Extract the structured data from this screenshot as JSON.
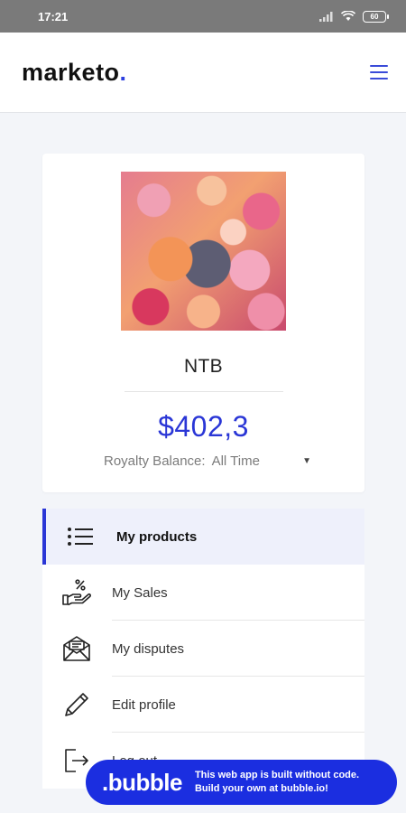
{
  "status_bar": {
    "time": "17:21",
    "battery": "60"
  },
  "header": {
    "logo_text": "marketo",
    "logo_dot": "."
  },
  "profile": {
    "name": "NTB",
    "balance": "$402,3",
    "balance_label": "Royalty Balance:",
    "balance_period": "All Time"
  },
  "nav": {
    "items": [
      {
        "label": "My products",
        "icon": "list-icon",
        "active": true
      },
      {
        "label": "My Sales",
        "icon": "hand-percent-icon",
        "active": false
      },
      {
        "label": "My disputes",
        "icon": "envelope-icon",
        "active": false
      },
      {
        "label": "Edit profile",
        "icon": "pencil-icon",
        "active": false
      },
      {
        "label": "Log out",
        "icon": "logout-icon",
        "active": false
      }
    ]
  },
  "bubble_badge": {
    "logo": ".bubble",
    "line1": "This web app is built without code.",
    "line2": "Build your own at bubble.io!"
  },
  "colors": {
    "accent": "#2a36d6",
    "badge": "#1b2ee0",
    "status_bar": "#7a7a7a"
  }
}
